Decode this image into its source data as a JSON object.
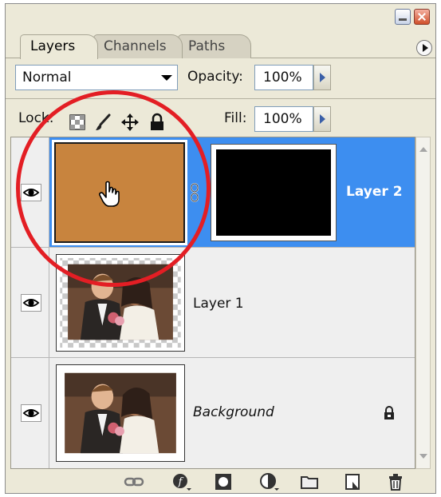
{
  "tabs": [
    {
      "label": "Layers",
      "active": true
    },
    {
      "label": "Channels",
      "active": false
    },
    {
      "label": "Paths",
      "active": false
    }
  ],
  "blend_mode": {
    "value": "Normal"
  },
  "opacity": {
    "label": "Opacity:",
    "value": "100%"
  },
  "lock": {
    "label": "Lock:",
    "icons": [
      "lock-transparent-pixels-icon",
      "lock-image-pixels-icon",
      "lock-position-icon",
      "lock-all-icon"
    ]
  },
  "fill": {
    "label": "Fill:",
    "value": "100%"
  },
  "layers": [
    {
      "name": "Layer 2",
      "selected": true,
      "visible": true,
      "thumbnail": "solid color fill",
      "fill_color": "#c8843e",
      "mask": "#000000",
      "linked_mask": true
    },
    {
      "name": "Layer 1",
      "selected": false,
      "visible": true,
      "thumbnail": "wedding couple photo with transparency"
    },
    {
      "name": "Background",
      "selected": false,
      "visible": true,
      "locked": true,
      "italic": true,
      "thumbnail": "wedding couple photo"
    }
  ],
  "bottom_toolbar": [
    "link-layers-icon",
    "layer-style-icon",
    "add-mask-icon",
    "adjustment-layer-icon",
    "new-group-icon",
    "new-layer-icon",
    "delete-layer-icon"
  ],
  "colors": {
    "selection": "#3d8ef0",
    "annotation": "#e31e24",
    "panel_bg": "#ece9d8"
  }
}
